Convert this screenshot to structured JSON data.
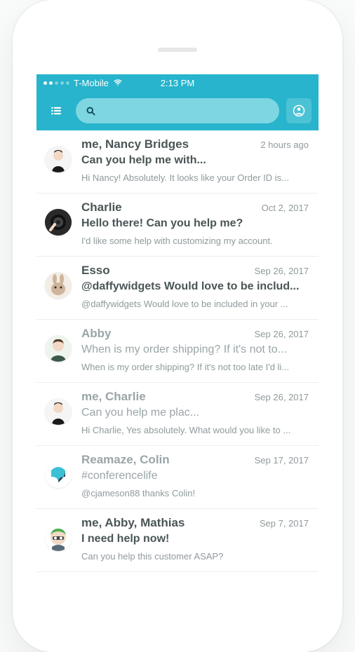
{
  "status": {
    "carrier": "T-Mobile",
    "time": "2:13 PM"
  },
  "search": {
    "placeholder": ""
  },
  "conversations": [
    {
      "sender": "me, Nancy Bridges",
      "timestamp": "2 hours ago",
      "subject": "Can you help me with...",
      "preview": "Hi Nancy! Absolutely. It looks like your Order ID is...",
      "faded": false,
      "avatar": "person-dark"
    },
    {
      "sender": "Charlie",
      "timestamp": "Oct 2, 2017",
      "subject": "Hello there! Can you help me?",
      "preview": "I'd like some help with customizing my account.",
      "faded": false,
      "avatar": "camera"
    },
    {
      "sender": "Esso",
      "timestamp": "Sep 26, 2017",
      "subject": "@daffywidgets Would love to be includ...",
      "preview": "@daffywidgets Would love to be included in your ...",
      "faded": false,
      "avatar": "bunny"
    },
    {
      "sender": "Abby",
      "timestamp": "Sep 26, 2017",
      "subject": "When is my order shipping? If it's not to...",
      "preview": "When is my order shipping? If it's not too late I'd li...",
      "faded": true,
      "avatar": "girl"
    },
    {
      "sender": "me, Charlie",
      "timestamp": "Sep 26, 2017",
      "subject": "Can you help me plac...",
      "preview": "Hi Charlie, Yes absolutely. What would you like to ...",
      "faded": true,
      "avatar": "person-dark"
    },
    {
      "sender": "Reamaze, Colin",
      "timestamp": "Sep 17, 2017",
      "subject": "#conferencelife",
      "preview": "@cjameson88 thanks Colin!",
      "faded": true,
      "avatar": "reamaze"
    },
    {
      "sender": "me, Abby, Mathias",
      "timestamp": "Sep 7, 2017",
      "subject": "I need help now!",
      "preview": "Can you help this customer ASAP?",
      "faded": false,
      "avatar": "cartoon"
    }
  ]
}
